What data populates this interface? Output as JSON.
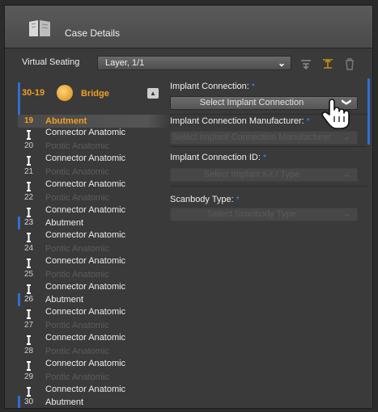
{
  "window": {
    "title": "Case Details",
    "icon": "book-icon"
  },
  "virtual_seating": {
    "label": "Virtual Seating",
    "selected_value": "Layer, 1/1",
    "tools": [
      "seat-down-icon",
      "seat-up-icon",
      "trash-icon"
    ]
  },
  "bridge": {
    "range": "30-19",
    "label": "Bridge",
    "icon": "bridge-teeth-icon",
    "collapse": "▲"
  },
  "teeth": [
    {
      "num": "19",
      "type": "Abutment",
      "state": "selected"
    },
    {
      "num": "20",
      "type": "Pontic Anatomic",
      "state": "pontic"
    },
    {
      "num": "21",
      "type": "Pontic Anatomic",
      "state": "pontic"
    },
    {
      "num": "22",
      "type": "Pontic Anatomic",
      "state": "pontic"
    },
    {
      "num": "23",
      "type": "Abutment",
      "state": "normal"
    },
    {
      "num": "24",
      "type": "Pontic Anatomic",
      "state": "pontic"
    },
    {
      "num": "25",
      "type": "Pontic Anatomic",
      "state": "pontic"
    },
    {
      "num": "26",
      "type": "Abutment",
      "state": "normal"
    },
    {
      "num": "27",
      "type": "Pontic Anatomic",
      "state": "pontic"
    },
    {
      "num": "28",
      "type": "Pontic Anatomic",
      "state": "pontic"
    },
    {
      "num": "29",
      "type": "Pontic Anatomic",
      "state": "pontic"
    },
    {
      "num": "30",
      "type": "Abutment",
      "state": "normal"
    }
  ],
  "connector_label": "Connector Anatomic",
  "fields": [
    {
      "label": "Implant Connection:",
      "required": "*",
      "value": "Select Implant Connection",
      "state": "active"
    },
    {
      "label": "Implant Connection Manufacturer:",
      "required": "*",
      "value": "Select Implant Connection Manufacturer",
      "state": "disabled"
    },
    {
      "label": "Implant Connection ID:",
      "required": "*",
      "value": "Select Implant Kit / Type",
      "state": "disabled"
    },
    {
      "label": "Scanbody Type:",
      "required": "*",
      "value": "Select Scanbody Type",
      "state": "disabled"
    }
  ],
  "dropdown_chevron": "❯",
  "colors": {
    "accent": "#f0a020",
    "required": "#3b8df2",
    "marker": "#2d6fd4"
  }
}
